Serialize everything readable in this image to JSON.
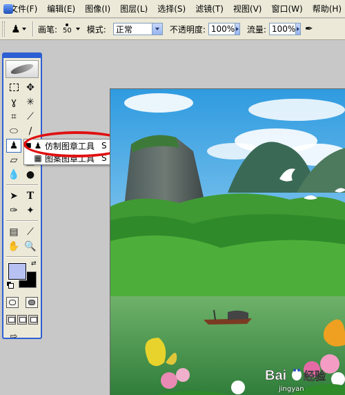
{
  "menubar": {
    "items": [
      "文件(F)",
      "编辑(E)",
      "图像(I)",
      "图层(L)",
      "选择(S)",
      "滤镜(T)",
      "视图(V)",
      "窗口(W)",
      "帮助(H)"
    ]
  },
  "options": {
    "brush_label": "画笔:",
    "brush_size": "50",
    "mode_label": "模式:",
    "mode_value": "正常",
    "opacity_label": "不透明度:",
    "opacity_value": "100%",
    "flow_label": "流量:",
    "flow_value": "100%"
  },
  "colors": {
    "foreground": "#b8c2f2",
    "background": "#000000",
    "accent": "#2d5fd3",
    "highlight": "#e01010"
  },
  "flyout": {
    "items": [
      {
        "label": "仿制图章工具",
        "shortcut": "S",
        "icon": "clone-stamp-icon",
        "selected": true
      },
      {
        "label": "图案图章工具",
        "shortcut": "S",
        "icon": "pattern-stamp-icon",
        "selected": false
      }
    ]
  },
  "watermark": {
    "logo_text": "Bai",
    "logo_suffix": "经验",
    "subtext": "jingyan"
  }
}
